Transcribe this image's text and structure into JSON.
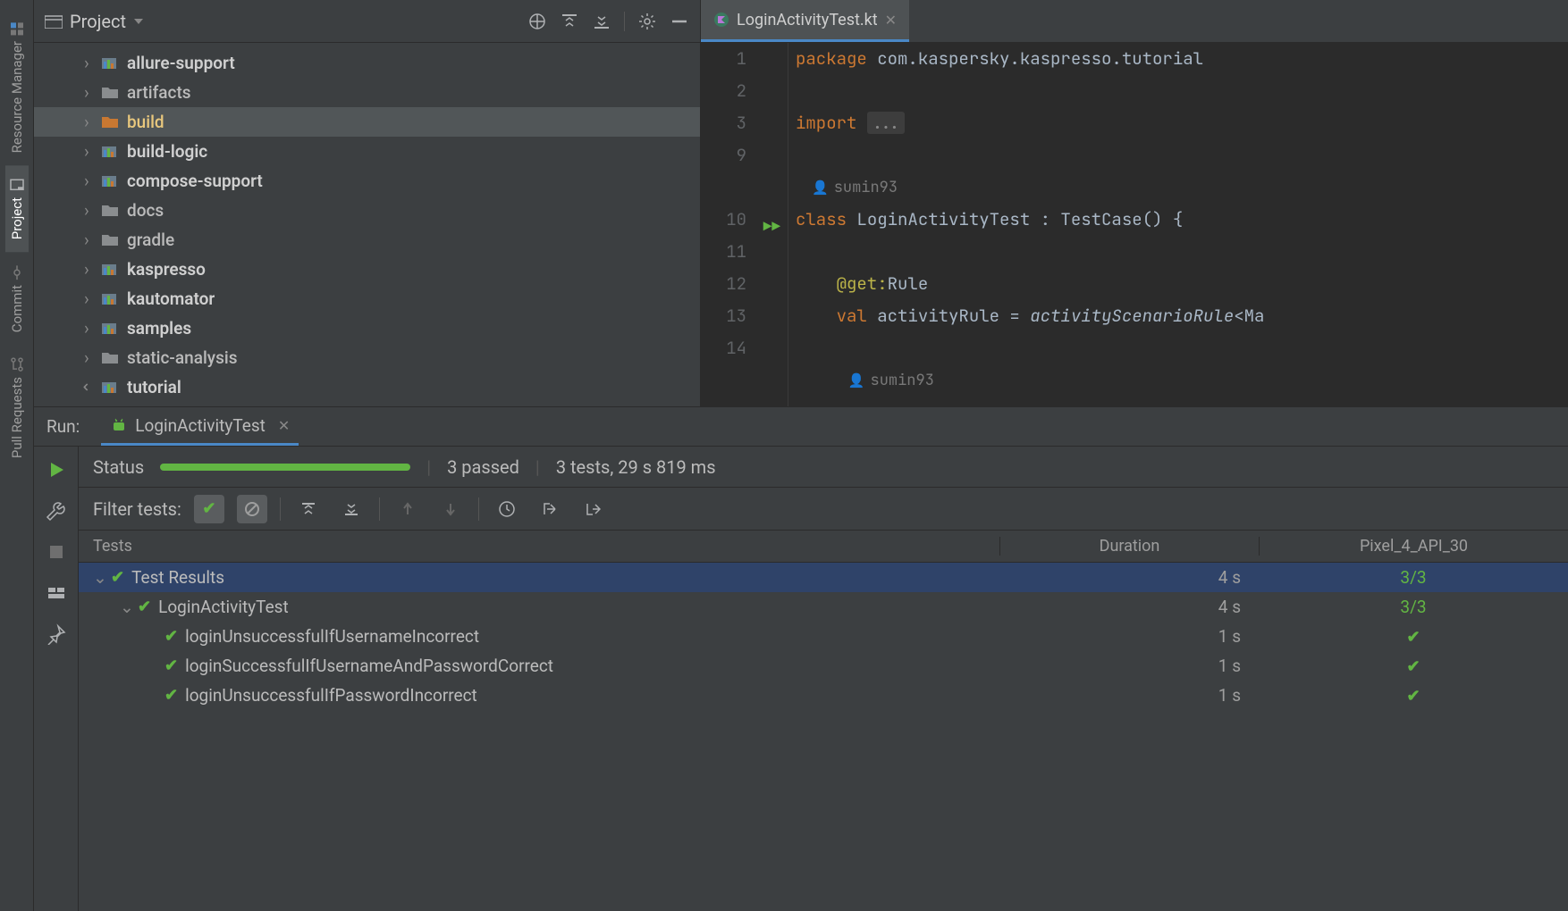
{
  "leftSidebar": {
    "items": [
      {
        "label": "Resource Manager",
        "active": false
      },
      {
        "label": "Project",
        "active": true
      },
      {
        "label": "Commit",
        "active": false
      },
      {
        "label": "Pull Requests",
        "active": false
      }
    ]
  },
  "projectPanel": {
    "title": "Project",
    "tree": [
      {
        "label": "allure-support",
        "icon": "module",
        "expanded": false
      },
      {
        "label": "artifacts",
        "icon": "folder",
        "expanded": false,
        "normal": true
      },
      {
        "label": "build",
        "icon": "folder-orange",
        "expanded": false,
        "selected": true
      },
      {
        "label": "build-logic",
        "icon": "module",
        "expanded": false
      },
      {
        "label": "compose-support",
        "icon": "module",
        "expanded": false
      },
      {
        "label": "docs",
        "icon": "folder",
        "expanded": false,
        "normal": true
      },
      {
        "label": "gradle",
        "icon": "folder",
        "expanded": false,
        "normal": true
      },
      {
        "label": "kaspresso",
        "icon": "module",
        "expanded": false
      },
      {
        "label": "kautomator",
        "icon": "module",
        "expanded": false
      },
      {
        "label": "samples",
        "icon": "module",
        "expanded": false
      },
      {
        "label": "static-analysis",
        "icon": "folder",
        "expanded": false,
        "normal": true
      },
      {
        "label": "tutorial",
        "icon": "module",
        "expanded": true
      }
    ]
  },
  "editor": {
    "tab": {
      "filename": "LoginActivityTest.kt"
    },
    "gutter": [
      "1",
      "2",
      "3",
      "9",
      "",
      "10",
      "11",
      "12",
      "13",
      "14",
      ""
    ],
    "author": "sumin93",
    "code": {
      "package_kw": "package",
      "package_name": " com.kaspersky.kaspresso.tutorial",
      "import_kw": "import",
      "import_fold": "...",
      "class_kw": "class",
      "class_name": " LoginActivityTest : TestCase() {",
      "ann": "@get:",
      "ann_name": "Rule",
      "val_kw": "val",
      "val_name": " activityRule = ",
      "val_call": "activityScenarioRule",
      "val_tail": "<Ma"
    }
  },
  "run": {
    "label": "Run:",
    "tabName": "LoginActivityTest",
    "status": {
      "label": "Status",
      "passed": "3 passed",
      "summary": "3 tests, 29 s 819 ms"
    },
    "filter": {
      "label": "Filter tests:"
    },
    "columns": {
      "tests": "Tests",
      "duration": "Duration",
      "device": "Pixel_4_API_30"
    },
    "rows": [
      {
        "indent": 0,
        "chevron": true,
        "name": "Test Results",
        "duration": "4 s",
        "device": "3/3",
        "selected": true
      },
      {
        "indent": 1,
        "chevron": true,
        "name": "LoginActivityTest",
        "duration": "4 s",
        "device": "3/3"
      },
      {
        "indent": 2,
        "chevron": false,
        "name": "loginUnsuccessfulIfUsernameIncorrect",
        "duration": "1 s",
        "device": "check"
      },
      {
        "indent": 2,
        "chevron": false,
        "name": "loginSuccessfulIfUsernameAndPasswordCorrect",
        "duration": "1 s",
        "device": "check"
      },
      {
        "indent": 2,
        "chevron": false,
        "name": "loginUnsuccessfulIfPasswordIncorrect",
        "duration": "1 s",
        "device": "check"
      }
    ]
  }
}
